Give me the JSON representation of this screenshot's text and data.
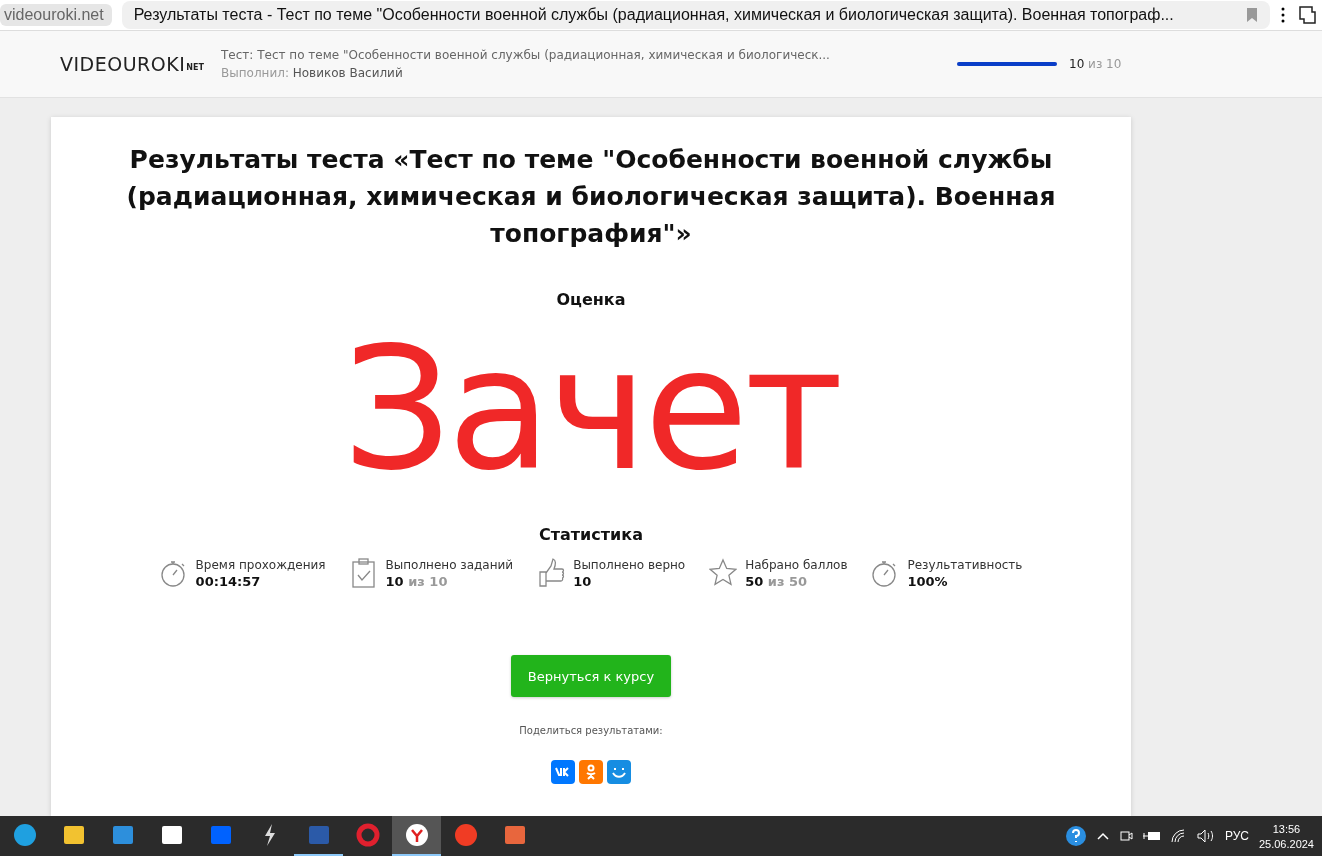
{
  "browser": {
    "address": "videouroki.net",
    "tab_title": "Результаты теста - Тест по теме \"Особенности военной службы (радиационная, химическая и биологическая защита). Военная топограф..."
  },
  "header": {
    "logo": "VIDEOUROKI",
    "logo_suffix": "NET",
    "test_label": "Тест:",
    "test_name": "Тест по теме \"Особенности военной службы (радиационная, химическая и биологическ...",
    "author_label": "Выполнил:",
    "author": "Новиков Василий",
    "progress": {
      "level": 1,
      "done": "10",
      "total": "из 10"
    }
  },
  "result": {
    "title": "Результаты теста «Тест по теме \"Особенности военной службы (радиационная, химическая и биологическая защита). Военная топография\"»",
    "grade_label": "Оценка",
    "grade": "Зачет",
    "stats_label": "Статистика",
    "stats": [
      {
        "kind": "stopwatch",
        "label": "Время прохождения",
        "value": "00:14:57"
      },
      {
        "kind": "clipboard",
        "label": "Выполнено заданий",
        "value": "10",
        "total": "из 10"
      },
      {
        "kind": "thumb",
        "label": "Выполнено верно",
        "value": "10"
      },
      {
        "kind": "star",
        "label": "Набрано баллов",
        "value": "50",
        "total": "из 50"
      },
      {
        "kind": "stopwatch",
        "label": "Результативность",
        "value": "100%"
      }
    ],
    "button": "Вернуться к курсу",
    "share_label": "Поделиться результатами:",
    "share": [
      {
        "kind": "vk",
        "color": "#0077ff"
      },
      {
        "kind": "ok",
        "color": "#ff7700"
      },
      {
        "kind": "mm",
        "color": "#168de2"
      }
    ]
  },
  "taskbar": {
    "apps": [
      {
        "kind": "edge",
        "selected": false,
        "running": false
      },
      {
        "kind": "folder",
        "selected": false,
        "running": false
      },
      {
        "kind": "mail",
        "selected": false,
        "running": false
      },
      {
        "kind": "amazon",
        "selected": false,
        "running": false
      },
      {
        "kind": "dropbox",
        "selected": false,
        "running": false
      },
      {
        "kind": "bolt",
        "selected": false,
        "running": false
      },
      {
        "kind": "word",
        "selected": false,
        "running": true
      },
      {
        "kind": "opera",
        "selected": false,
        "running": false
      },
      {
        "kind": "ybrowser",
        "selected": true,
        "running": true
      },
      {
        "kind": "yandex",
        "selected": false,
        "running": false
      },
      {
        "kind": "slides",
        "selected": false,
        "running": false
      }
    ],
    "language": "РУС",
    "time": "13:56",
    "date": "25.06.2024"
  }
}
